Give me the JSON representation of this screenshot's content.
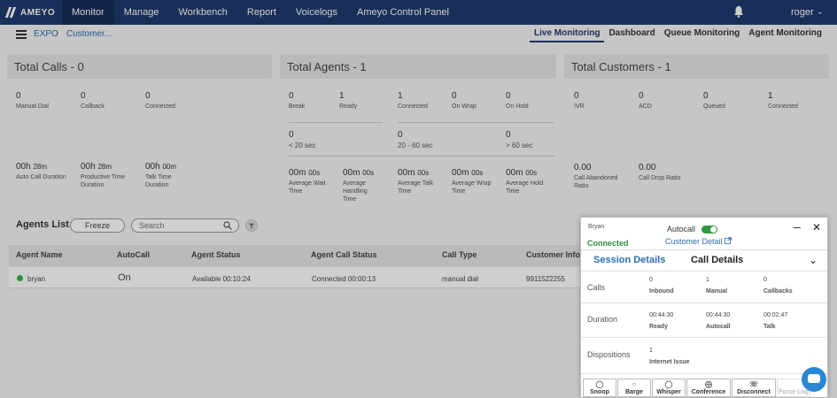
{
  "nav": {
    "logo": "AMEYO",
    "items": [
      {
        "label": "Monitor",
        "active": true
      },
      {
        "label": "Manage"
      },
      {
        "label": "Workbench"
      },
      {
        "label": "Report"
      },
      {
        "label": "Voicelogs"
      },
      {
        "label": "Ameyo Control Panel"
      }
    ],
    "user": "roger"
  },
  "breadcrumb": {
    "root": "EXPO",
    "current": "Customer..."
  },
  "subtabs": [
    {
      "label": "Live Monitoring",
      "active": true
    },
    {
      "label": "Dashboard"
    },
    {
      "label": "Queue Monitoring"
    },
    {
      "label": "Agent Monitoring"
    }
  ],
  "calls": {
    "title": "Total Calls - 0",
    "manual_dial": {
      "value": "0",
      "label": "Manual Dial"
    },
    "callback": {
      "value": "0",
      "label": "Callback"
    },
    "connected": {
      "value": "0",
      "label": "Connected"
    },
    "auto_call_duration": {
      "h": "00h",
      "m": "28m",
      "label": "Auto Call Duration"
    },
    "productive_time": {
      "h": "00h",
      "m": "28m",
      "label": "Productive Time Duration"
    },
    "talk_time": {
      "h": "00h",
      "m": "00m",
      "label": "Talk Time Duration"
    }
  },
  "agents": {
    "title": "Total Agents - 1",
    "break": {
      "value": "0",
      "label": "Break"
    },
    "ready": {
      "value": "1",
      "label": "Ready"
    },
    "connected": {
      "value": "1",
      "label": "Connected"
    },
    "on_wrap": {
      "value": "0",
      "label": "On Wrap"
    },
    "on_hold": {
      "value": "0",
      "label": "On Hold"
    },
    "lt20": {
      "value": "0",
      "label": "< 20 sec"
    },
    "b20_60": {
      "value": "0",
      "label": "20 - 60 sec"
    },
    "gt60": {
      "value": "0",
      "label": "> 60 sec"
    },
    "avg_wait": {
      "m": "00m",
      "s": "00s",
      "label": "Average Wait Time"
    },
    "avg_handling": {
      "m": "00m",
      "s": "00s",
      "label": "Average Handling Time"
    },
    "avg_talk": {
      "m": "00m",
      "s": "00s",
      "label": "Average Talk Time"
    },
    "avg_wrap": {
      "m": "00m",
      "s": "00s",
      "label": "Average Wrap Time"
    },
    "avg_hold": {
      "m": "00m",
      "s": "00s",
      "label": "Average Hold Time"
    }
  },
  "customers": {
    "title": "Total Customers - 1",
    "ivr": {
      "value": "0",
      "label": "IVR"
    },
    "acd": {
      "value": "0",
      "label": "ACD"
    },
    "queued": {
      "value": "0",
      "label": "Queued"
    },
    "connected": {
      "value": "1",
      "label": "Connected"
    },
    "call_abandoned": {
      "value": "0.00",
      "label": "Call Abandoned Ratio"
    },
    "call_drop": {
      "value": "0.00",
      "label": "Call Drop Ratio"
    }
  },
  "agents_list": {
    "title": "Agents List",
    "freeze_label": "Freeze",
    "search_placeholder": "Search",
    "columns": [
      "Agent Name",
      "AutoCall",
      "Agent Status",
      "Agent Call Status",
      "Call Type",
      "Customer Info"
    ],
    "rows": [
      {
        "name": "bryan",
        "autocall": "On",
        "status": "Available 00:10:24",
        "call_status": "Connected 00:00:13",
        "call_type": "manual dial",
        "customer_info": "9911522255"
      }
    ]
  },
  "popup": {
    "agent": "Bryan",
    "autocall_label": "Autocall",
    "autocall_on": true,
    "state": "Connected",
    "customer_detail_link": "Customer Detail",
    "tabs": {
      "session": "Session Details",
      "call": "Call Details"
    },
    "calls_label": "Calls",
    "calls": [
      {
        "value": "0",
        "label": "Inbound"
      },
      {
        "value": "1",
        "label": "Manual"
      },
      {
        "value": "0",
        "label": "Callbacks"
      }
    ],
    "duration_label": "Duration",
    "durations": [
      {
        "value": "00:44:30",
        "label": "Ready"
      },
      {
        "value": "00:44:30",
        "label": "Autocall"
      },
      {
        "value": "00:02:47",
        "label": "Talk"
      }
    ],
    "dispositions_label": "Dispositions",
    "dispositions": [
      {
        "value": "1",
        "label": "Internet Issue"
      }
    ],
    "actions": [
      "Snoop",
      "Barge",
      "Whisper",
      "Conference",
      "Disconnect",
      "Force Log"
    ]
  }
}
